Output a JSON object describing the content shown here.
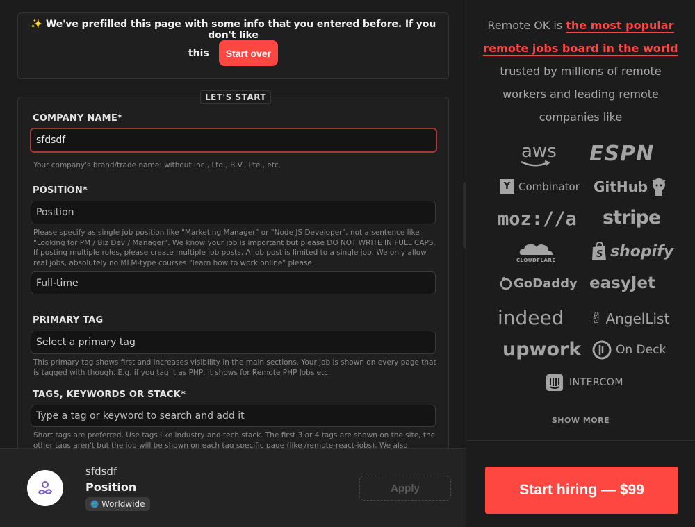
{
  "prefill": {
    "sparkle": "✨",
    "text_line1": "We've prefilled this page with some info that you entered before. If you don't like",
    "text_line2": "this",
    "start_over": "Start over"
  },
  "form": {
    "section_legend": "LET'S START",
    "company": {
      "label": "COMPANY NAME*",
      "value": "sfdsdf",
      "help": "Your company's brand/trade name: without Inc., Ltd., B.V., Pte., etc."
    },
    "position": {
      "label": "POSITION*",
      "placeholder": "Position",
      "help": "Please specify as single job position like \"Marketing Manager\" or \"Node JS Developer\", not a sentence like \"Looking for PM / Biz Dev / Manager\". We know your job is important but please DO NOT WRITE IN FULL CAPS. If posting multiple roles, please create multiple job posts. A job post is limited to a single job. We only allow real jobs, absolutely no MLM-type courses \"learn how to work online\" please."
    },
    "employment_type": {
      "value": "Full-time"
    },
    "primary_tag": {
      "label": "PRIMARY TAG",
      "placeholder": "Select a primary tag",
      "help": "This primary tag shows first and increases visibility in the main sections. Your job is shown on every page that is tagged with though. E.g. if you tag it as PHP, it shows for Remote PHP Jobs etc."
    },
    "tags": {
      "label": "TAGS, KEYWORDS OR STACK*",
      "placeholder": "Type a tag or keyword to search and add it",
      "help": "Short tags are preferred. Use tags like industry and tech stack. The first 3 or 4 tags are shown on the site, the other tags aren't but the job will be shown on each tag specific page (like /remote-react-jobs). We also sometimes generate tags"
    }
  },
  "sidebar": {
    "intro_before": "Remote OK is",
    "intro_highlight_1": "the most popular",
    "intro_highlight_2": "remote jobs board in the world",
    "intro_after_1": "trusted by millions of remote",
    "intro_after_2": "workers and leading remote",
    "intro_after_3": "companies like",
    "logos": [
      "aws",
      "ESPN",
      "Combinator",
      "GitHub",
      "moz://a",
      "stripe",
      "CLOUDFLARE",
      "shopify",
      "GoDaddy",
      "easyJet",
      "indeed",
      "AngelList",
      "upwork",
      "On Deck",
      "INTERCOM"
    ],
    "logo_y_mark": "Y",
    "show_more": "SHOW MORE",
    "hire_button": "Start hiring — $99"
  },
  "preview": {
    "company": "sfdsdf",
    "position": "Position",
    "location_icon": "globe-icon",
    "location": "Worldwide",
    "apply": "Apply"
  }
}
